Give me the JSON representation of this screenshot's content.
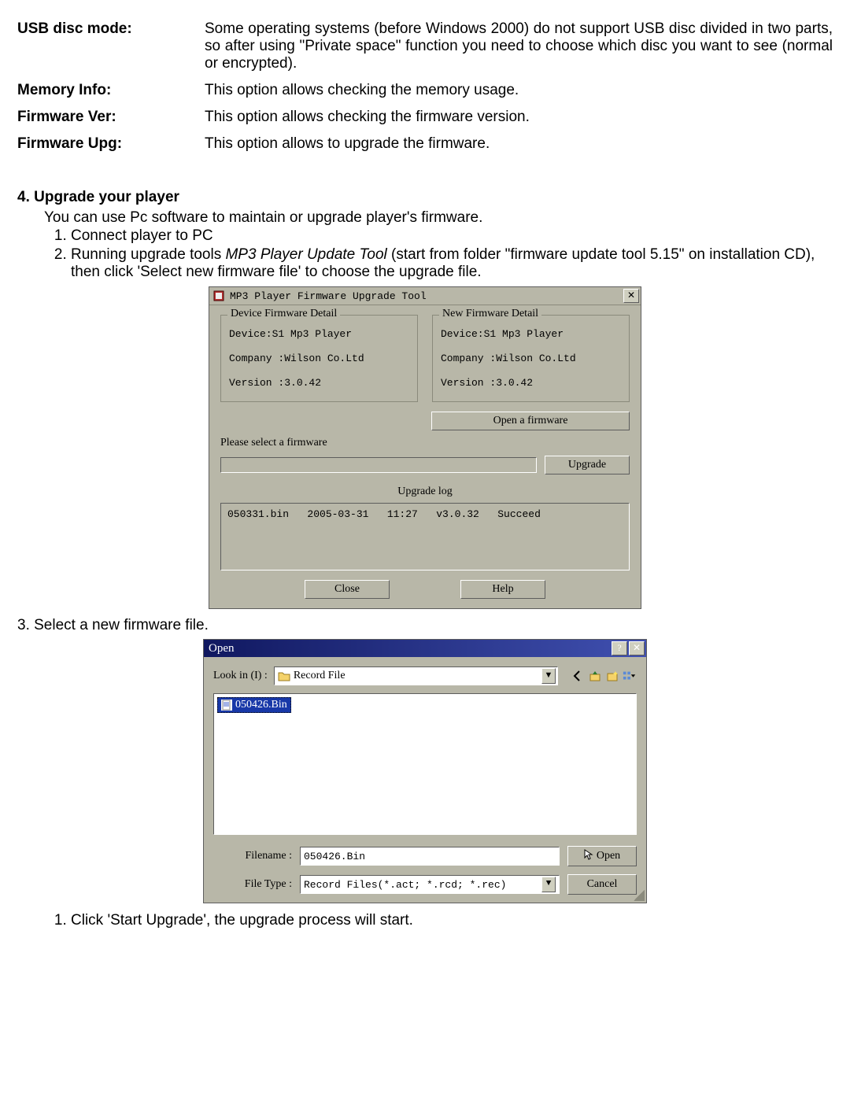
{
  "definitions": [
    {
      "label": "USB disc mode:",
      "desc": "Some operating systems (before Windows 2000) do not support USB disc divided in two parts, so after using \"Private space\" function you need to choose which disc you want to see (normal or encrypted)."
    },
    {
      "label": "Memory Info:",
      "desc": "This option allows checking the memory usage."
    },
    {
      "label": "Firmware Ver:",
      "desc": "This option allows checking the firmware version."
    },
    {
      "label": "Firmware Upg:",
      "desc": "This option allows to upgrade the firmware."
    }
  ],
  "section": {
    "title": "4. Upgrade your player",
    "intro": "You can use Pc software to maintain or upgrade player's firmware.",
    "step1": "Connect player to PC",
    "step2_pre": "Running upgrade tools ",
    "step2_tool": "MP3 Player Update Tool",
    "step2_post": " (start from folder \"firmware update tool 5.15\" on installation CD), then click 'Select new firmware file' to choose the upgrade file.",
    "step3": "3. Select a new firmware file.",
    "final": "Click 'Start Upgrade', the upgrade process will start."
  },
  "dlg1": {
    "title": "MP3 Player Firmware Upgrade Tool",
    "left_legend": "Device Firmware Detail",
    "right_legend": "New Firmware Detail",
    "device_label": "Device:S1 Mp3 Player",
    "company_label": "Company :Wilson Co.Ltd",
    "version_label": "Version :3.0.42",
    "open_btn": "Open a firmware",
    "msg": "Please select a firmware",
    "upgrade_btn": "Upgrade",
    "log_title": "Upgrade log",
    "log_line": "050331.bin   2005-03-31   11:27   v3.0.32   Succeed",
    "close_btn": "Close",
    "help_btn": "Help"
  },
  "dlg2": {
    "title": "Open",
    "lookin_label": "Look in   (I) :",
    "folder": "Record File",
    "file": "050426.Bin",
    "filename_label": "Filename :",
    "filename_value": "050426.Bin",
    "filetype_label": "File Type :",
    "filetype_value": "Record Files(*.act; *.rcd; *.rec)",
    "open_btn": "Open",
    "cancel_btn": "Cancel"
  }
}
